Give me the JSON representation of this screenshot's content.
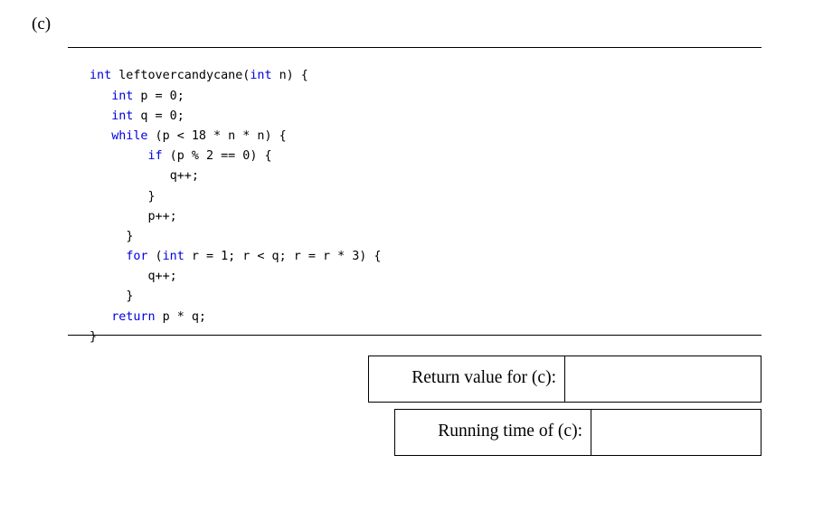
{
  "part": {
    "label": "(c)"
  },
  "code": {
    "language": "java",
    "keyword_color": "#0000e0",
    "text_color": "#000000",
    "lines": [
      {
        "indent": 0,
        "tokens": [
          {
            "t": "int",
            "kw": true
          },
          {
            "t": " leftovercandycane(",
            "kw": false
          },
          {
            "t": "int",
            "kw": true
          },
          {
            "t": " n) {",
            "kw": false
          }
        ]
      },
      {
        "indent": 3,
        "tokens": [
          {
            "t": "int",
            "kw": true
          },
          {
            "t": " p = 0;",
            "kw": false
          }
        ]
      },
      {
        "indent": 3,
        "tokens": [
          {
            "t": "int",
            "kw": true
          },
          {
            "t": " q = 0;",
            "kw": false
          }
        ]
      },
      {
        "indent": 3,
        "tokens": [
          {
            "t": "while",
            "kw": true
          },
          {
            "t": " (p < 18 * n * n) {",
            "kw": false
          }
        ]
      },
      {
        "indent": 8,
        "tokens": [
          {
            "t": "if",
            "kw": true
          },
          {
            "t": " (p % 2 == 0) {",
            "kw": false
          }
        ]
      },
      {
        "indent": 11,
        "tokens": [
          {
            "t": "q++;",
            "kw": false
          }
        ]
      },
      {
        "indent": 8,
        "tokens": [
          {
            "t": "}",
            "kw": false
          }
        ]
      },
      {
        "indent": 8,
        "tokens": [
          {
            "t": "p++;",
            "kw": false
          }
        ]
      },
      {
        "indent": 5,
        "tokens": [
          {
            "t": "}",
            "kw": false
          }
        ]
      },
      {
        "indent": 5,
        "tokens": [
          {
            "t": "for",
            "kw": true
          },
          {
            "t": " (",
            "kw": false
          },
          {
            "t": "int",
            "kw": true
          },
          {
            "t": " r = 1; r < q; r = r * 3) {",
            "kw": false
          }
        ]
      },
      {
        "indent": 8,
        "tokens": [
          {
            "t": "q++;",
            "kw": false
          }
        ]
      },
      {
        "indent": 5,
        "tokens": [
          {
            "t": "}",
            "kw": false
          }
        ]
      },
      {
        "indent": 3,
        "tokens": [
          {
            "t": "return",
            "kw": true
          },
          {
            "t": " p * q;",
            "kw": false
          }
        ]
      },
      {
        "indent": 0,
        "tokens": [
          {
            "t": "}",
            "kw": false
          }
        ]
      }
    ],
    "plain_text": "int leftovercandycane(int n) {\n   int p = 0;\n   int q = 0;\n   while (p < 18 * n * n) {\n        if (p % 2 == 0) {\n           q++;\n        }\n        p++;\n     }\n     for (int r = 1; r < q; r = r * 3) {\n        q++;\n     }\n   return p * q;\n}"
  },
  "answers": [
    {
      "id": "return-value",
      "label": "Return value for (c):",
      "value": ""
    },
    {
      "id": "running-time",
      "label": "Running time of (c):",
      "value": ""
    }
  ]
}
